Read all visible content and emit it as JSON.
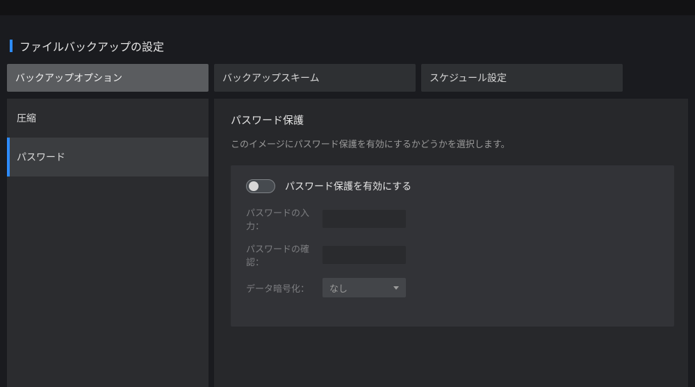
{
  "header": {
    "page_title": "ファイルバックアップの設定"
  },
  "tabs": [
    {
      "label": "バックアップオプション"
    },
    {
      "label": "バックアップスキーム"
    },
    {
      "label": "スケジュール設定"
    }
  ],
  "sidebar": {
    "items": [
      {
        "label": "圧縮"
      },
      {
        "label": "パスワード"
      }
    ]
  },
  "main": {
    "section_title": "パスワード保護",
    "section_desc": "このイメージにパスワード保護を有効にするかどうかを選択します。",
    "toggle_label": "パスワード保護を有効にする",
    "rows": {
      "pw_label": "パスワードの入力：",
      "pw_confirm_label": "パスワードの確認：",
      "crypt_label": "データ暗号化：",
      "crypt_value": "なし"
    }
  }
}
